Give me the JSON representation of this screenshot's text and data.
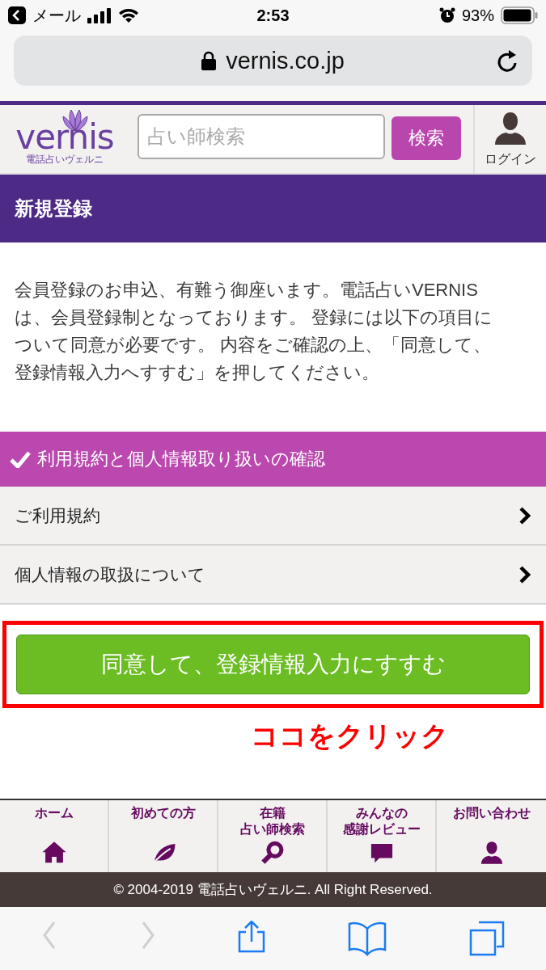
{
  "status_bar": {
    "back_app": "メール",
    "time": "2:53",
    "battery": "93%"
  },
  "url_bar": {
    "url": "vernis.co.jp"
  },
  "header": {
    "logo": "vernis",
    "logo_tagline": "電話占いヴェルニ",
    "search": {
      "placeholder": "占い師検索"
    },
    "search_button": "検索",
    "login": "ログイン"
  },
  "page_title": "新規登録",
  "intro": "会員登録のお申込、有難う御座います。電話占いVERNISは、会員登録制となっております。 登録には以下の項目について同意が必要です。 内容をご確認の上、「同意して、登録情報入力へすすむ」を押してください。",
  "consent": {
    "heading": "利用規約と個人情報取り扱いの確認",
    "items": [
      {
        "label": "ご利用規約"
      },
      {
        "label": "個人情報の取扱について"
      }
    ]
  },
  "agree_button": "同意して、登録情報入力にすすむ",
  "annotation": "ココをクリック",
  "bottom_nav": [
    {
      "lines": [
        "ホーム"
      ],
      "kind": "home"
    },
    {
      "lines": [
        "初めての方"
      ],
      "kind": "leaf"
    },
    {
      "lines": [
        "在籍",
        "占い師検索"
      ],
      "kind": "search"
    },
    {
      "lines": [
        "みんなの",
        "感謝レビュー"
      ],
      "kind": "chat"
    },
    {
      "lines": [
        "お問い合わせ"
      ],
      "kind": "person"
    }
  ],
  "footer": "© 2004-2019 電話占いヴェルニ. All Right Reserved.",
  "toolbar": [
    {
      "kind": "back",
      "disabled": true
    },
    {
      "kind": "forward",
      "disabled": true
    },
    {
      "kind": "share",
      "disabled": false
    },
    {
      "kind": "bookmarks",
      "disabled": false
    },
    {
      "kind": "tabs",
      "disabled": false
    }
  ]
}
